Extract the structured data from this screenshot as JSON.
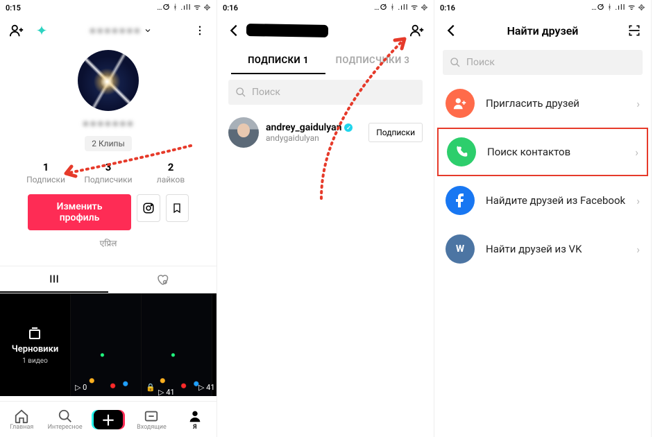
{
  "status": {
    "time1": "0:15",
    "time2": "0:16",
    "time3": "0:16",
    "icons": "…ⵚ ᚼ .ıll ᯤ ᪣"
  },
  "screen1": {
    "username_masked": "●●●●●●●",
    "clips_chip": "2 Клипы",
    "stats": [
      {
        "n": "1",
        "l": "Подписки"
      },
      {
        "n": "3",
        "l": "Подписчики"
      },
      {
        "n": "2",
        "l": "лайков"
      }
    ],
    "edit_btn": "Изменить профиль",
    "bio": "एप्रिल",
    "drafts_title": "Черновики",
    "drafts_count": "1 видео",
    "plays": [
      "▷ 0",
      "🔒",
      "▷ 41"
    ],
    "nav": [
      "Главная",
      "Интересное",
      "",
      "Входящие",
      "Я"
    ]
  },
  "screen2": {
    "tabs": [
      "ПОДПИСКИ 1",
      "ПОДПИСЧИКИ 3"
    ],
    "search_ph": "Поиск",
    "user": {
      "name": "andrey_gaidulyan",
      "handle": "andygaidulyan",
      "btn": "Подписки"
    }
  },
  "screen3": {
    "title": "Найти друзей",
    "search_ph": "Поиск",
    "opts": [
      "Пригласить друзей",
      "Поиск контактов",
      "Найдите друзей из Facebook",
      "Найти друзей из VK"
    ]
  }
}
